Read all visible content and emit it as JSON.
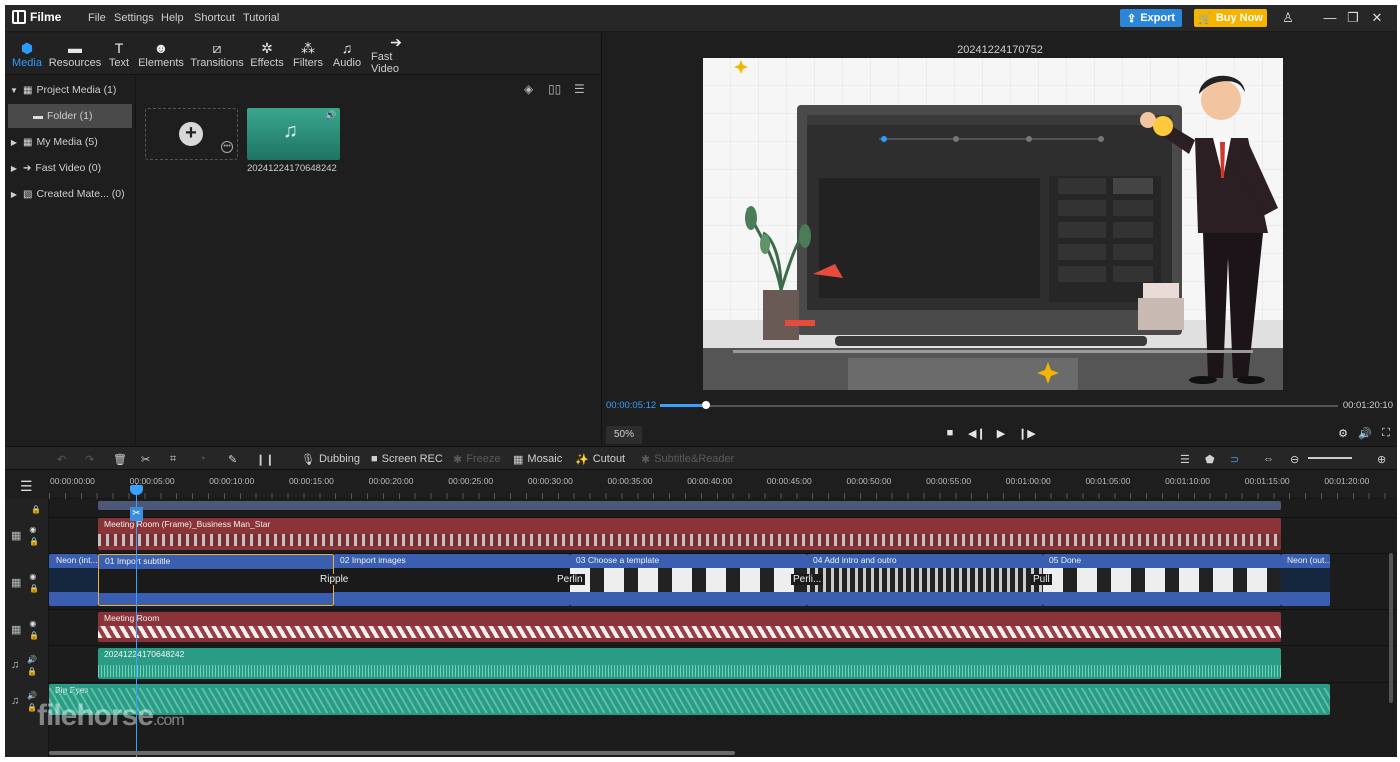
{
  "app": {
    "name": "Filme"
  },
  "menu": [
    "File",
    "Settings",
    "Help",
    "Shortcut",
    "Tutorial"
  ],
  "header": {
    "export_label": "Export",
    "buy_label": "Buy Now"
  },
  "tabs": [
    {
      "label": "Media",
      "icon": "media-icon",
      "active": true
    },
    {
      "label": "Resources",
      "icon": "resources-icon"
    },
    {
      "label": "Text",
      "icon": "text-icon"
    },
    {
      "label": "Elements",
      "icon": "elements-icon"
    },
    {
      "label": "Transitions",
      "icon": "transitions-icon"
    },
    {
      "label": "Effects",
      "icon": "effects-icon"
    },
    {
      "label": "Filters",
      "icon": "filters-icon"
    },
    {
      "label": "Audio",
      "icon": "audio-icon"
    },
    {
      "label": "Fast Video",
      "icon": "fast-video-icon"
    }
  ],
  "sidebar": {
    "items": [
      {
        "label": "Project Media (1)"
      },
      {
        "label": "Folder (1)"
      },
      {
        "label": "My Media (5)"
      },
      {
        "label": "Fast Video (0)"
      },
      {
        "label": "Created Mate... (0)"
      }
    ]
  },
  "media": {
    "file_name": "20241224170648242"
  },
  "preview": {
    "title": "20241224170752",
    "current_time": "00:00:05:12",
    "total_time": "00:01:20:10",
    "zoom": "50%",
    "progress": 0.068
  },
  "timeline_toolbar": {
    "dubbing": "Dubbing",
    "screen_rec": "Screen REC",
    "freeze": "Freeze",
    "mosaic": "Mosaic",
    "cutout": "Cutout",
    "subtitle_reader": "Subtitle&Reader"
  },
  "ruler": {
    "labels": [
      "00:00:00:00",
      "00:00:05:00",
      "00:00:10:00",
      "00:00:15:00",
      "00:00:20:00",
      "00:00:25:00",
      "00:00:30:00",
      "00:00:35:00",
      "00:00:40:00",
      "00:00:45:00",
      "00:00:50:00",
      "00:00:55:00",
      "00:01:00:00",
      "00:01:05:00",
      "00:01:10:00",
      "00:01:15:00",
      "00:01:20:00"
    ]
  },
  "tracks": {
    "overlay_clip": "Meeting Room (Frame)_Business Man_Star",
    "main_clips": [
      "Neon (int...",
      "01 Import subtitle",
      "02 Import images",
      "03 Choose a template",
      "04 Add intro and outro",
      "05 Done",
      "Neon (out..."
    ],
    "transitions": [
      "Ripple",
      "Perlin",
      "Perli...",
      "Pull"
    ],
    "background_clip": "Meeting Room",
    "audio_clip": "20241224170648242",
    "music_clip": "Big Eyes"
  },
  "watermark": {
    "main": "filehorse",
    "suffix": ".com"
  }
}
